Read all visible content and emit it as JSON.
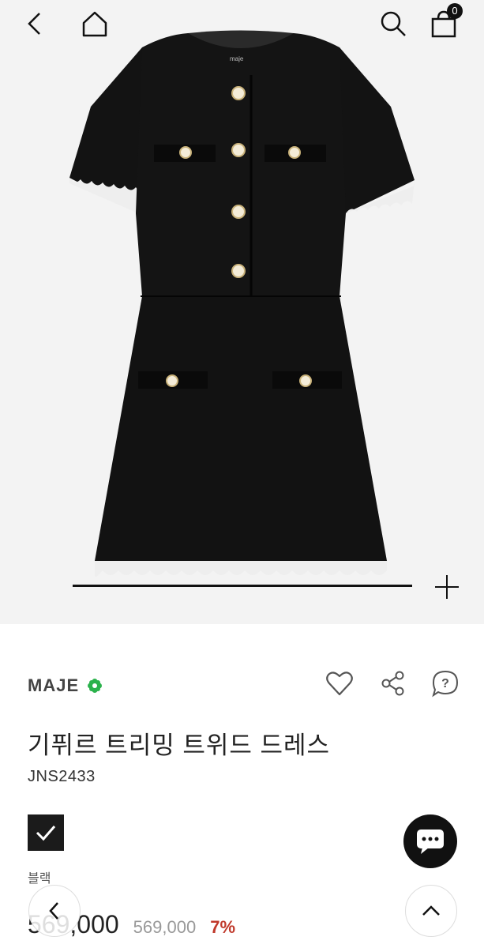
{
  "header": {
    "cart_count": "0"
  },
  "product_image": {
    "label_tag": "maje"
  },
  "product": {
    "brand": "MAJE",
    "title": "기퓌르 트리밍 트위드 드레스",
    "code": "JNS2433",
    "color_name": "블랙",
    "price": "569,000",
    "original_price": "569,000",
    "discount": "7%"
  },
  "icons": {
    "back": "chevron-left-icon",
    "home": "home-icon",
    "search": "search-icon",
    "cart": "shopping-bag-icon",
    "zoom": "plus-icon",
    "wish": "heart-icon",
    "share": "share-icon",
    "qna": "question-bubble-icon",
    "chat": "chat-bubble-icon",
    "scroll_top": "chevron-up-icon"
  },
  "colors": {
    "accent": "#111111",
    "discount": "#c0392b",
    "brand_badge": "#2bb24c"
  }
}
